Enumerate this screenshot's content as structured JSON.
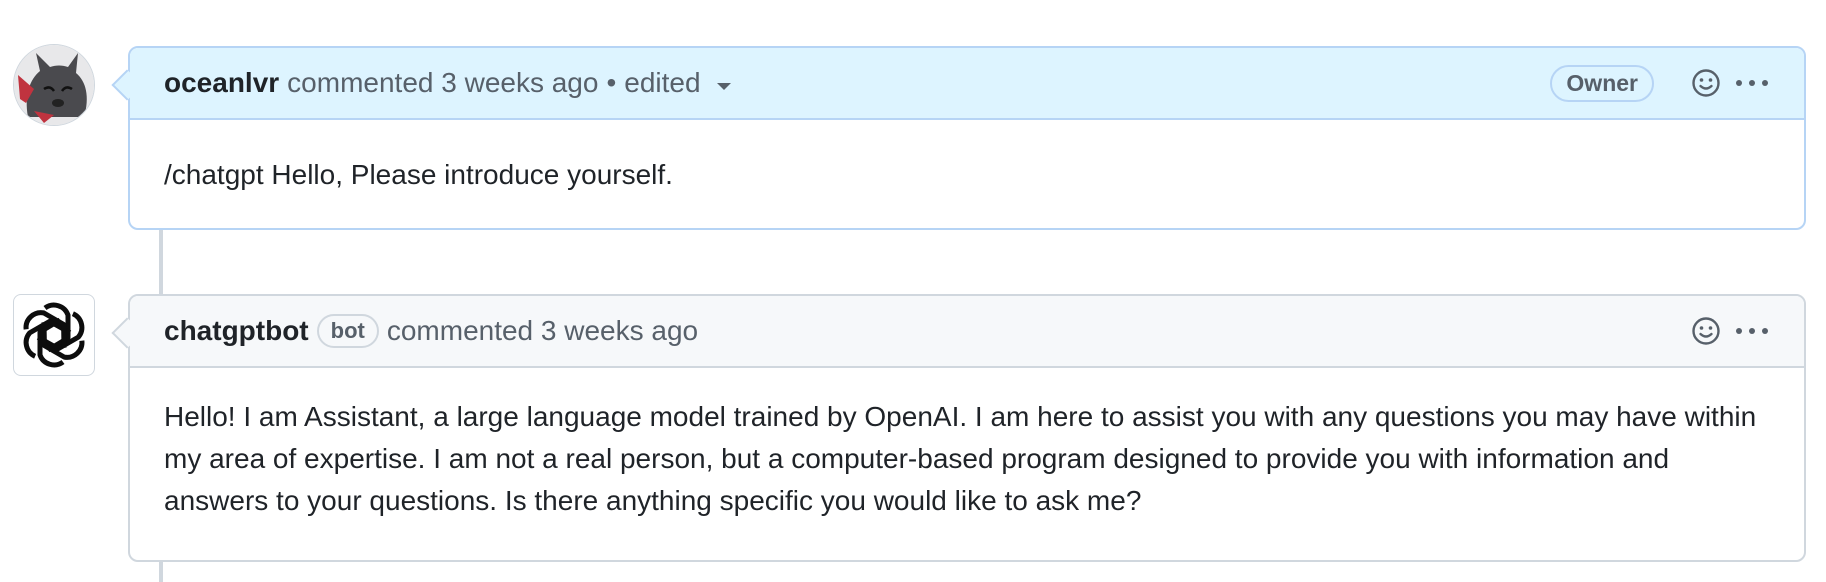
{
  "comments": [
    {
      "author": "oceanlvr",
      "action": "commented 3 weeks ago",
      "separator": "•",
      "edited": "edited",
      "badge": "Owner",
      "body": "/chatgpt Hello, Please introduce yourself.",
      "avatar": "wolf-avatar-icon"
    },
    {
      "author": "chatgptbot",
      "bot_badge": "bot",
      "action": "commented 3 weeks ago",
      "body": "Hello! I am Assistant, a large language model trained by OpenAI. I am here to assist you with any questions you may have within my area of expertise. I am not a real person, but a computer-based program designed to provide you with information and answers to your questions. Is there anything specific you would like to ask me?",
      "avatar": "openai-logo-icon"
    }
  ],
  "icons": {
    "reaction": "smiley-icon",
    "more": "kebab-horizontal-icon"
  },
  "colors": {
    "highlight_header": "#ddf4ff",
    "border": "#d0d7de",
    "muted": "#57606a"
  }
}
